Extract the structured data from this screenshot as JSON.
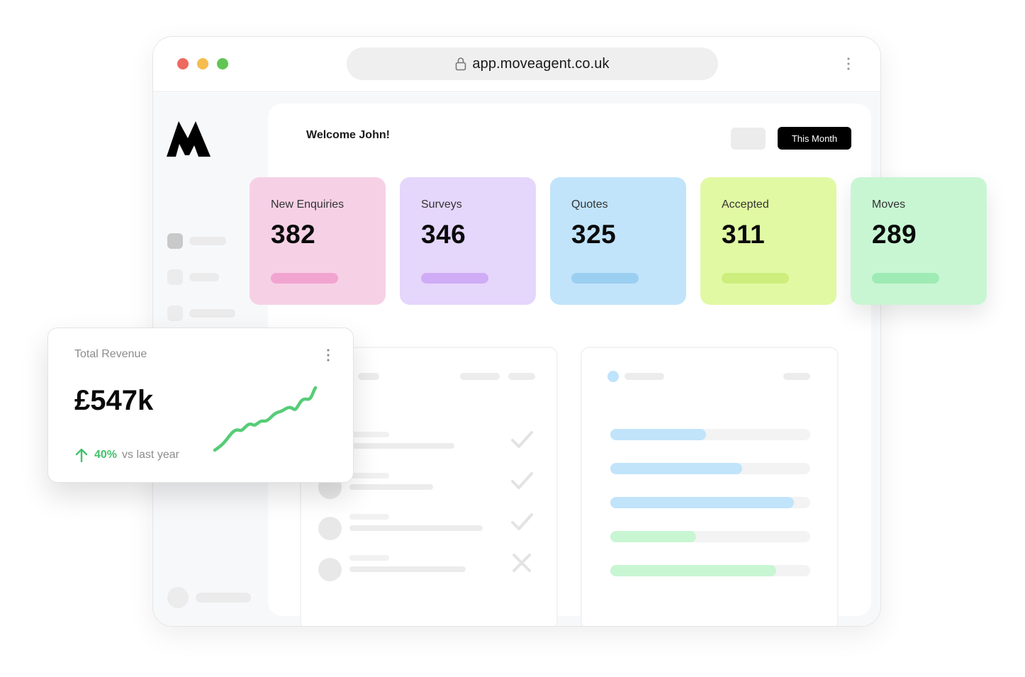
{
  "browser": {
    "url": "app.moveagent.co.uk",
    "traffic_light_colors": [
      "#ee6a5f",
      "#f5bd4f",
      "#61c554"
    ]
  },
  "header": {
    "welcome": "Welcome John!",
    "period_button": "This Month"
  },
  "stats": [
    {
      "label": "New Enquiries",
      "value": "382",
      "bg": "#f6d1e6",
      "bar": "#f2a4d0"
    },
    {
      "label": "Surveys",
      "value": "346",
      "bg": "#e5d6fb",
      "bar": "#cfacf5"
    },
    {
      "label": "Quotes",
      "value": "325",
      "bg": "#c1e4fb",
      "bar": "#9bcff2"
    },
    {
      "label": "Accepted",
      "value": "311",
      "bg": "#e1f9a3",
      "bar": "#cdee7d"
    },
    {
      "label": "Moves",
      "value": "289",
      "bg": "#c8f6d3",
      "bar": "#9eebb5"
    }
  ],
  "revenue": {
    "label": "Total Revenue",
    "value": "£547k",
    "change": "40%",
    "change_suffix": "vs last year",
    "accent": "#43c26b"
  },
  "status_list": [
    "check",
    "check",
    "check",
    "cross"
  ],
  "progress_bars": [
    {
      "fraction": 0.48,
      "color": "#c1e4fb"
    },
    {
      "fraction": 0.66,
      "color": "#c1e4fb"
    },
    {
      "fraction": 0.92,
      "color": "#c1e4fb"
    },
    {
      "fraction": 0.43,
      "color": "#c8f6d3"
    },
    {
      "fraction": 0.83,
      "color": "#c8f6d3"
    }
  ],
  "icons": {
    "logo": "moveagent-logo",
    "lock": "lock-icon",
    "menu": "vertical-dots-icon",
    "trend": "arrow-up-icon",
    "check": "check-icon",
    "cross": "cross-icon"
  }
}
